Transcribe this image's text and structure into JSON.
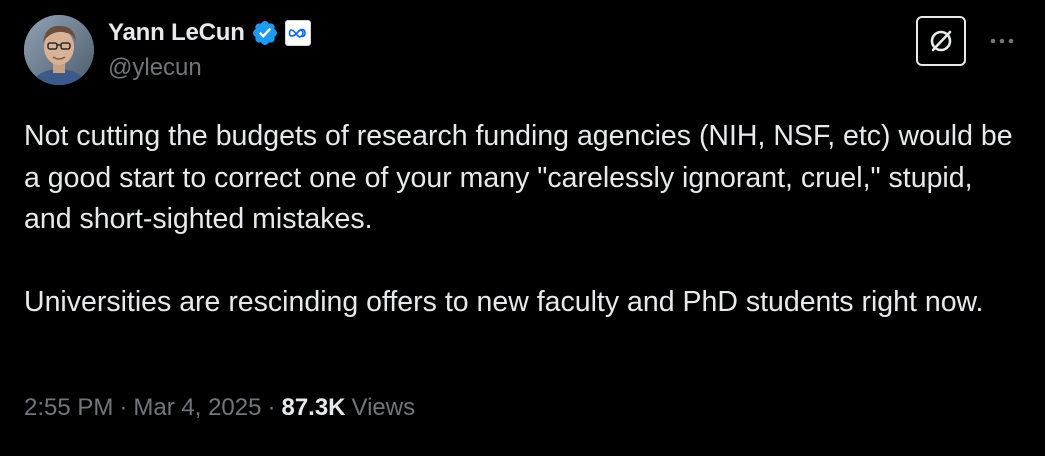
{
  "author": {
    "display_name": "Yann LeCun",
    "handle": "@ylecun",
    "verified_icon": "verified-badge-icon",
    "affiliation_icon": "meta-logo-icon",
    "verified_color": "#1d9bf0",
    "affiliation_color": "#0866ff"
  },
  "actions": {
    "grok_icon": "grok-icon",
    "more_icon": "more-horizontal-icon"
  },
  "tweet": {
    "paragraphs": [
      "Not cutting the budgets of research funding agencies (NIH, NSF, etc) would be a good start to correct one of your many \"carelessly ignorant, cruel,\" stupid, and short-sighted mistakes.",
      "Universities are rescinding offers to new faculty and PhD students right now."
    ]
  },
  "meta": {
    "time": "2:55 PM",
    "separator": "·",
    "date": "Mar 4, 2025",
    "views_count": "87.3K",
    "views_label": "Views"
  },
  "colors": {
    "background": "#000000",
    "primary_text": "#e7e9ea",
    "secondary_text": "#71767b"
  }
}
